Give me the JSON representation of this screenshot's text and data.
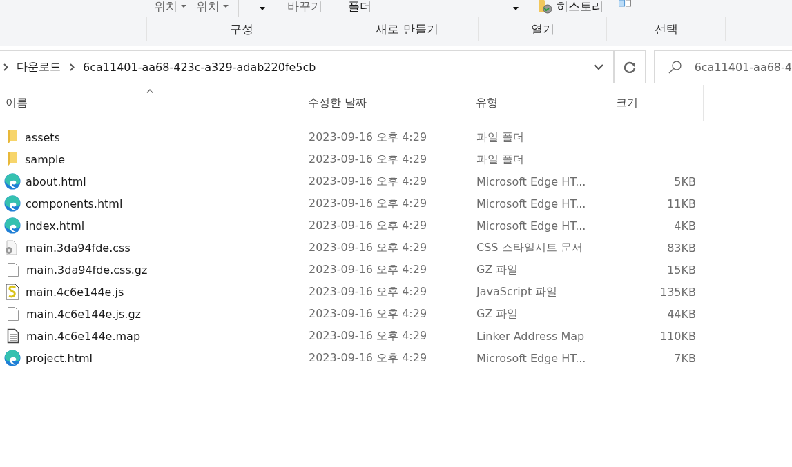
{
  "ribbon": {
    "top_items": [
      {
        "kind": "dropdown",
        "label": "위치"
      },
      {
        "kind": "dropdown",
        "label": "위치"
      },
      {
        "kind": "separator"
      },
      {
        "kind": "caret"
      },
      {
        "kind": "text",
        "label": "바꾸기"
      },
      {
        "kind": "text",
        "label": "폴더",
        "strong": true
      },
      {
        "kind": "caret"
      },
      {
        "kind": "history",
        "label": "히스토리"
      },
      {
        "kind": "checkbox"
      }
    ],
    "groups": [
      {
        "label": "구성"
      },
      {
        "label": "새로 만들기"
      },
      {
        "label": "열기"
      },
      {
        "label": "선택"
      }
    ]
  },
  "address": {
    "crumbs": [
      "다운로드",
      "6ca11401-aa68-423c-a329-adab220fe5cb"
    ]
  },
  "search": {
    "value": "6ca11401-aa68-4"
  },
  "table": {
    "columns": [
      "이름",
      "수정한 날짜",
      "유형",
      "크기"
    ],
    "rows": [
      {
        "kind": "folder",
        "name": "assets",
        "date": "2023-09-16 오후 4:29",
        "type": "파일 폴더",
        "size": ""
      },
      {
        "kind": "folder",
        "name": "sample",
        "date": "2023-09-16 오후 4:29",
        "type": "파일 폴더",
        "size": ""
      },
      {
        "kind": "edge",
        "name": "about.html",
        "date": "2023-09-16 오후 4:29",
        "type": "Microsoft Edge HT...",
        "size": "5KB"
      },
      {
        "kind": "edge",
        "name": "components.html",
        "date": "2023-09-16 오후 4:29",
        "type": "Microsoft Edge HT...",
        "size": "11KB"
      },
      {
        "kind": "edge",
        "name": "index.html",
        "date": "2023-09-16 오후 4:29",
        "type": "Microsoft Edge HT...",
        "size": "4KB"
      },
      {
        "kind": "css",
        "name": "main.3da94fde.css",
        "date": "2023-09-16 오후 4:29",
        "type": "CSS 스타일시트 문서",
        "size": "83KB"
      },
      {
        "kind": "blank",
        "name": "main.3da94fde.css.gz",
        "date": "2023-09-16 오후 4:29",
        "type": "GZ 파일",
        "size": "15KB"
      },
      {
        "kind": "js",
        "name": "main.4c6e144e.js",
        "date": "2023-09-16 오후 4:29",
        "type": "JavaScript 파일",
        "size": "135KB"
      },
      {
        "kind": "blank",
        "name": "main.4c6e144e.js.gz",
        "date": "2023-09-16 오후 4:29",
        "type": "GZ 파일",
        "size": "44KB"
      },
      {
        "kind": "text",
        "name": "main.4c6e144e.map",
        "date": "2023-09-16 오후 4:29",
        "type": "Linker Address Map",
        "size": "110KB"
      },
      {
        "kind": "edge",
        "name": "project.html",
        "date": "2023-09-16 오후 4:29",
        "type": "Microsoft Edge HT...",
        "size": "7KB"
      }
    ]
  }
}
